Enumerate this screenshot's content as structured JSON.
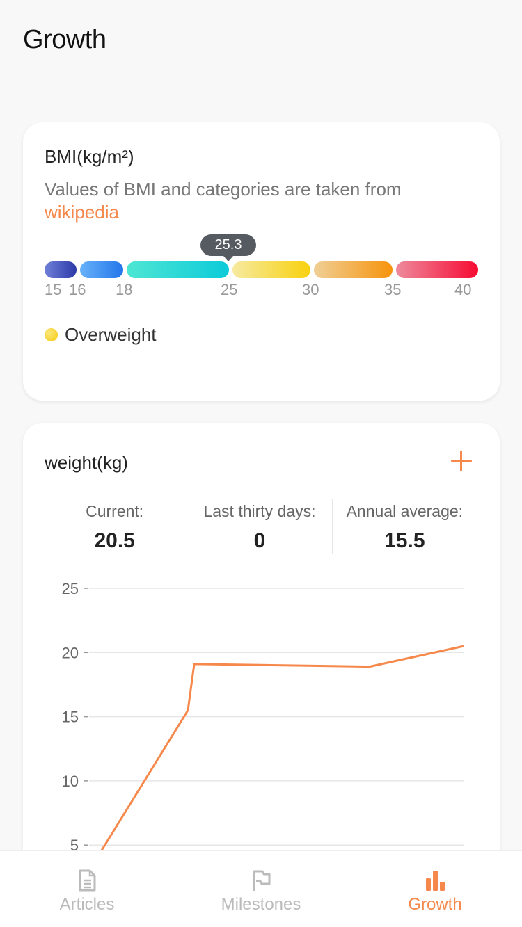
{
  "page": {
    "title": "Growth"
  },
  "bmi": {
    "title": "BMI(kg/m²)",
    "description": "Values of BMI and categories are taken from",
    "link_text": "wikipedia",
    "value": "25.3",
    "current_bmi": 25.3,
    "scale_min": 15,
    "scale_max": 40,
    "ticks": [
      "15",
      "16",
      "18",
      "25",
      "30",
      "35",
      "40"
    ],
    "category": "Overweight"
  },
  "weight": {
    "title": "weight(kg)",
    "stats": [
      {
        "label": "Current:",
        "value": "20.5"
      },
      {
        "label": "Last thirty days:",
        "value": "0"
      },
      {
        "label": "Annual average:",
        "value": "15.5"
      }
    ]
  },
  "chart_data": {
    "type": "line",
    "yticks": [
      5,
      10,
      15,
      20,
      25
    ],
    "ylim": [
      5,
      25
    ],
    "series": [
      {
        "values": [
          4.5,
          15.5,
          19.1,
          18.9,
          20.5
        ]
      }
    ],
    "grid": true,
    "color": "#f5884a"
  },
  "nav": {
    "items": [
      {
        "label": "Articles",
        "icon": "document-icon",
        "active": false
      },
      {
        "label": "Milestones",
        "icon": "flag-icon",
        "active": false
      },
      {
        "label": "Growth",
        "icon": "bar-chart-icon",
        "active": true
      }
    ]
  },
  "colors": {
    "accent": "#f5884a",
    "tooltip": "#555b61"
  }
}
